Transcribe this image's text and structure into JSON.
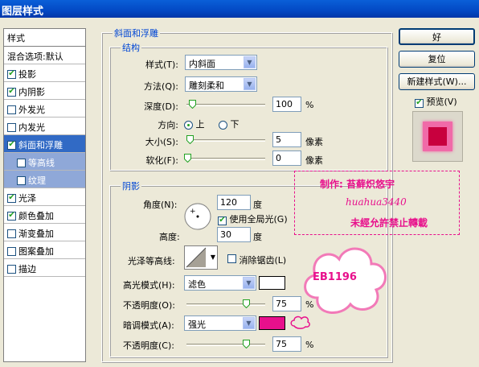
{
  "window": {
    "title": "图层样式"
  },
  "sidebar": {
    "header": "样式",
    "blend_options": "混合选项:默认",
    "items": [
      {
        "label": "投影",
        "checked": true
      },
      {
        "label": "内阴影",
        "checked": true
      },
      {
        "label": "外发光",
        "checked": false
      },
      {
        "label": "内发光",
        "checked": false
      },
      {
        "label": "斜面和浮雕",
        "checked": true,
        "selected": true
      },
      {
        "label": "等高线",
        "checked": false,
        "sub": true
      },
      {
        "label": "纹理",
        "checked": false,
        "sub": true
      },
      {
        "label": "光泽",
        "checked": true
      },
      {
        "label": "颜色叠加",
        "checked": true
      },
      {
        "label": "渐变叠加",
        "checked": false
      },
      {
        "label": "图案叠加",
        "checked": false
      },
      {
        "label": "描边",
        "checked": false
      }
    ]
  },
  "bevel": {
    "group_title": "斜面和浮雕",
    "structure_title": "结构",
    "style_label": "样式(T):",
    "style_value": "内斜面",
    "technique_label": "方法(Q):",
    "technique_value": "雕刻柔和",
    "depth_label": "深度(D):",
    "depth_value": "100",
    "depth_unit": "%",
    "direction_label": "方向:",
    "dir_up": "上",
    "dir_down": "下",
    "size_label": "大小(S):",
    "size_value": "5",
    "size_unit": "像素",
    "soften_label": "软化(F):",
    "soften_value": "0",
    "soften_unit": "像素"
  },
  "shading": {
    "title": "阴影",
    "angle_label": "角度(N):",
    "angle_value": "120",
    "angle_unit": "度",
    "global_light_label": "使用全局光(G)",
    "altitude_label": "高度:",
    "altitude_value": "30",
    "altitude_unit": "度",
    "gloss_contour_label": "光泽等高线:",
    "antialias_label": "消除锯齿(L)",
    "highlight_mode_label": "高光模式(H):",
    "highlight_mode_value": "滤色",
    "highlight_color": "#ffffff",
    "opacity_label": "不透明度(O):",
    "opacity_value": "75",
    "opacity_unit": "%",
    "shadow_mode_label": "暗调模式(A):",
    "shadow_mode_value": "强光",
    "shadow_color": "#e8108c",
    "opacity2_label": "不透明度(C):",
    "opacity2_value": "75",
    "opacity2_unit": "%"
  },
  "buttons": {
    "ok": "好",
    "reset": "复位",
    "new_style": "新建样式(W)...",
    "preview": "预览(V)"
  },
  "watermark": {
    "line1": "制作: 苔藓炽悠宇",
    "line2": "huahua3440",
    "line3": "未經允許禁止轉載",
    "cloud": "EB1196"
  }
}
